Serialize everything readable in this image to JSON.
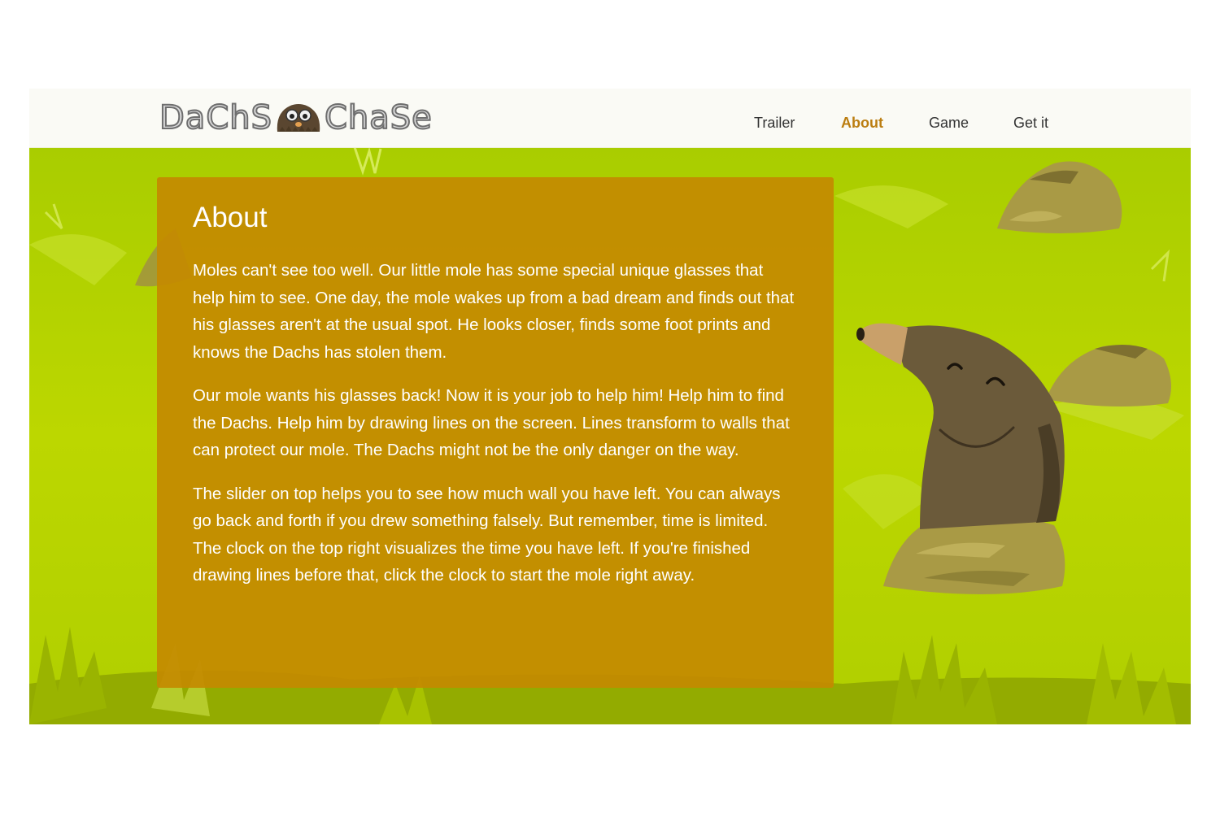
{
  "brand": {
    "word_left": "DaChS",
    "word_right": "ChaSe",
    "logo_icon": "mole-face-icon"
  },
  "nav": {
    "items": [
      {
        "label": "Trailer"
      },
      {
        "label": "About",
        "active": true
      },
      {
        "label": "Game"
      },
      {
        "label": "Get it"
      }
    ]
  },
  "about": {
    "title": "About",
    "paragraphs": [
      "Moles can't see too well. Our little mole has some special unique glasses that help him to see. One day, the mole wakes up from a bad dream and finds out that his glasses aren't at the usual spot. He looks closer, finds some foot prints and knows the Dachs has stolen them.",
      "Our mole wants his glasses back! Now it is your job to help him! Help him to find the Dachs. Help him by drawing lines on the screen. Lines transform to walls that can protect our mole. The Dachs might not be the only danger on the way.",
      "The slider on top helps you to see how much wall you have left. You can always go back and forth if you drew something falsely. But remember, time is limited. The clock on the top right visualizes the time you have left. If you're finished drawing lines before that, click the clock to start the mole right away."
    ]
  },
  "colors": {
    "accent": "#bb7d10",
    "panel": "#c48a00",
    "grass": "#b5d400",
    "grass_dark": "#8ca600",
    "mole": "#6b5a3a",
    "mole_nose": "#c9a06a",
    "dirt": "#a99a45"
  }
}
